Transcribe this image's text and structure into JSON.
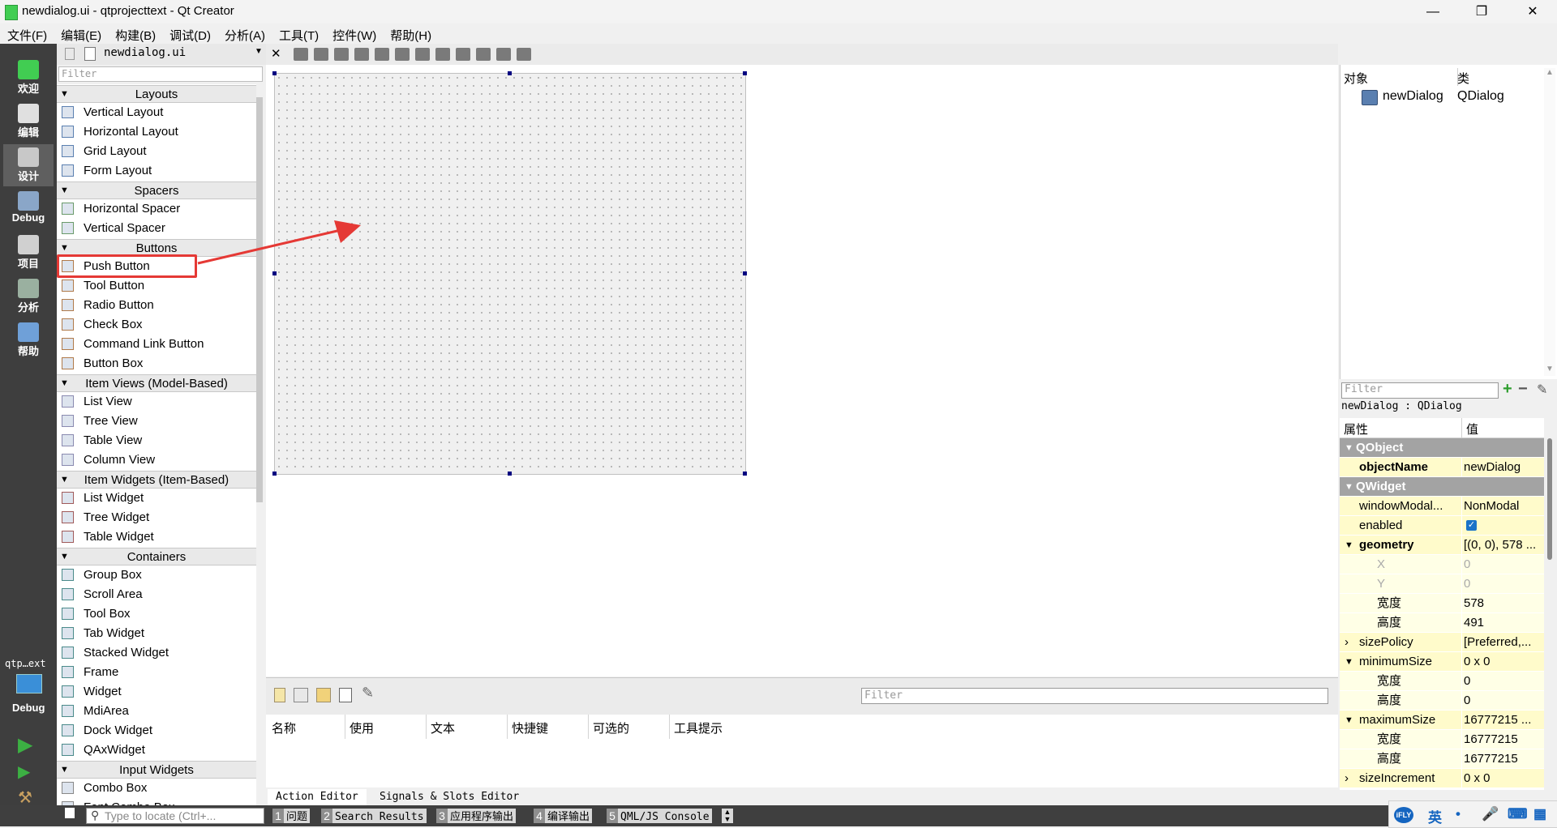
{
  "window": {
    "title": "newdialog.ui - qtprojecttext - Qt Creator",
    "minimize": "—",
    "maximize": "❐",
    "close": "✕"
  },
  "menubar": [
    "文件(F)",
    "编辑(E)",
    "构建(B)",
    "调试(D)",
    "分析(A)",
    "工具(T)",
    "控件(W)",
    "帮助(H)"
  ],
  "modes": [
    {
      "label": "欢迎",
      "icon": "qt-logo-icon",
      "color": "#41cd52"
    },
    {
      "label": "编辑",
      "icon": "edit-document-icon",
      "color": "#e0e0e0"
    },
    {
      "label": "设计",
      "icon": "design-pen-icon",
      "color": "#c8c8c8"
    },
    {
      "label": "Debug",
      "icon": "debug-bug-icon",
      "color": "#8aa6c8"
    },
    {
      "label": "项目",
      "icon": "project-icon",
      "color": "#d0d0d0"
    },
    {
      "label": "分析",
      "icon": "analyze-icon",
      "color": "#9ab0a0"
    },
    {
      "label": "帮助",
      "icon": "help-icon",
      "color": "#6fa0d8"
    }
  ],
  "kit": {
    "project": "qtp…ext",
    "mode": "Debug"
  },
  "file_selector": {
    "filename": "newdialog.ui"
  },
  "widgetbox": {
    "filter_placeholder": "Filter",
    "categories": [
      {
        "name": "Layouts",
        "items": [
          "Vertical Layout",
          "Horizontal Layout",
          "Grid Layout",
          "Form Layout"
        ]
      },
      {
        "name": "Spacers",
        "items": [
          "Horizontal Spacer",
          "Vertical Spacer"
        ]
      },
      {
        "name": "Buttons",
        "items": [
          "Push Button",
          "Tool Button",
          "Radio Button",
          "Check Box",
          "Command Link Button",
          "Button Box"
        ]
      },
      {
        "name": "Item Views (Model-Based)",
        "items": [
          "List View",
          "Tree View",
          "Table View",
          "Column View"
        ]
      },
      {
        "name": "Item Widgets (Item-Based)",
        "items": [
          "List Widget",
          "Tree Widget",
          "Table Widget"
        ]
      },
      {
        "name": "Containers",
        "items": [
          "Group Box",
          "Scroll Area",
          "Tool Box",
          "Tab Widget",
          "Stacked Widget",
          "Frame",
          "Widget",
          "MdiArea",
          "Dock Widget",
          "QAxWidget"
        ]
      },
      {
        "name": "Input Widgets",
        "items": [
          "Combo Box",
          "Font Combo Box"
        ]
      }
    ]
  },
  "action_editor": {
    "filter_placeholder": "Filter",
    "columns": [
      "名称",
      "使用",
      "文本",
      "快捷键",
      "可选的",
      "工具提示"
    ],
    "tabs": [
      "Action Editor",
      "Signals & Slots Editor"
    ]
  },
  "object_inspector": {
    "headers": [
      "对象",
      "类"
    ],
    "object": {
      "name": "newDialog",
      "class": "QDialog"
    }
  },
  "property_editor": {
    "filter_placeholder": "Filter",
    "class_label": "newDialog : QDialog",
    "headers": [
      "属性",
      "值"
    ],
    "rows": [
      {
        "type": "group",
        "name": "QObject"
      },
      {
        "type": "prop",
        "name": "objectName",
        "value": "newDialog",
        "bold": true
      },
      {
        "type": "group",
        "name": "QWidget"
      },
      {
        "type": "prop",
        "name": "windowModal...",
        "value": "NonModal"
      },
      {
        "type": "prop",
        "name": "enabled",
        "value": "",
        "checkbox": true
      },
      {
        "type": "prop",
        "name": "geometry",
        "value": "[(0, 0), 578 ...",
        "bold": true,
        "expanded": true
      },
      {
        "type": "sub",
        "name": "X",
        "value": "0",
        "dim": true
      },
      {
        "type": "sub",
        "name": "Y",
        "value": "0",
        "dim": true
      },
      {
        "type": "sub",
        "name": "宽度",
        "value": "578"
      },
      {
        "type": "sub",
        "name": "高度",
        "value": "491"
      },
      {
        "type": "prop",
        "name": "sizePolicy",
        "value": "[Preferred,...",
        "collapsed": true
      },
      {
        "type": "prop",
        "name": "minimumSize",
        "value": "0 x 0",
        "expanded": true
      },
      {
        "type": "sub",
        "name": "宽度",
        "value": "0"
      },
      {
        "type": "sub",
        "name": "高度",
        "value": "0"
      },
      {
        "type": "prop",
        "name": "maximumSize",
        "value": "16777215 ...",
        "expanded": true
      },
      {
        "type": "sub",
        "name": "宽度",
        "value": "16777215"
      },
      {
        "type": "sub",
        "name": "高度",
        "value": "16777215"
      },
      {
        "type": "prop",
        "name": "sizeIncrement",
        "value": "0 x 0",
        "collapsed": true
      }
    ]
  },
  "statusbar": {
    "locate_placeholder": "Type to locate (Ctrl+...",
    "tabs": [
      {
        "num": "1",
        "label": "问题"
      },
      {
        "num": "2",
        "label": "Search Results"
      },
      {
        "num": "3",
        "label": "应用程序输出"
      },
      {
        "num": "4",
        "label": "编译输出"
      },
      {
        "num": "5",
        "label": "QML/JS Console"
      }
    ]
  },
  "ime": {
    "logo": "iFLY",
    "lang": "英"
  },
  "colors": {
    "accent_red": "#e53935",
    "selection_handle": "#000080",
    "property_group": "#a3a3a3",
    "property_row": "#fffbcb"
  }
}
